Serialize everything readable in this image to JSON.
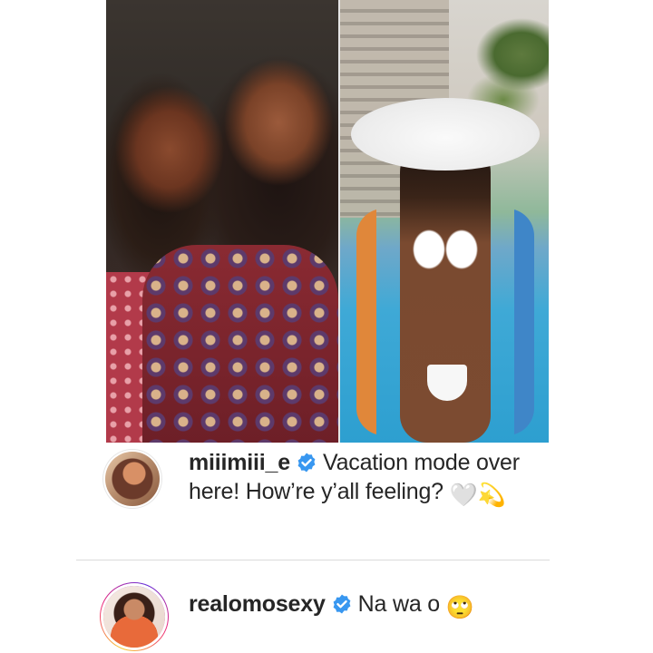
{
  "post": {
    "images": [
      {
        "description_icon": "photo-two-women-icon"
      },
      {
        "description_icon": "photo-pool-woman-icon"
      }
    ]
  },
  "comments": [
    {
      "username": "miiimiii_e",
      "verified": true,
      "text_line": "Vacation mode over here! How’re y’all feeling?",
      "emojis": [
        "🤍",
        "💫"
      ],
      "avatar_icon": "user-avatar-icon",
      "has_story_ring": false
    },
    {
      "username": "realomosexy",
      "verified": true,
      "text_line": "Na wa o",
      "emojis": [
        "🙄"
      ],
      "avatar_icon": "user-avatar-icon",
      "has_story_ring": true
    }
  ],
  "colors": {
    "text": "#262626",
    "verified_badge": "#3897f0",
    "divider": "#dbdbdb",
    "story_ring_start": "#f9ce34",
    "story_ring_mid": "#ee2a7b",
    "story_ring_end": "#6228d7"
  }
}
